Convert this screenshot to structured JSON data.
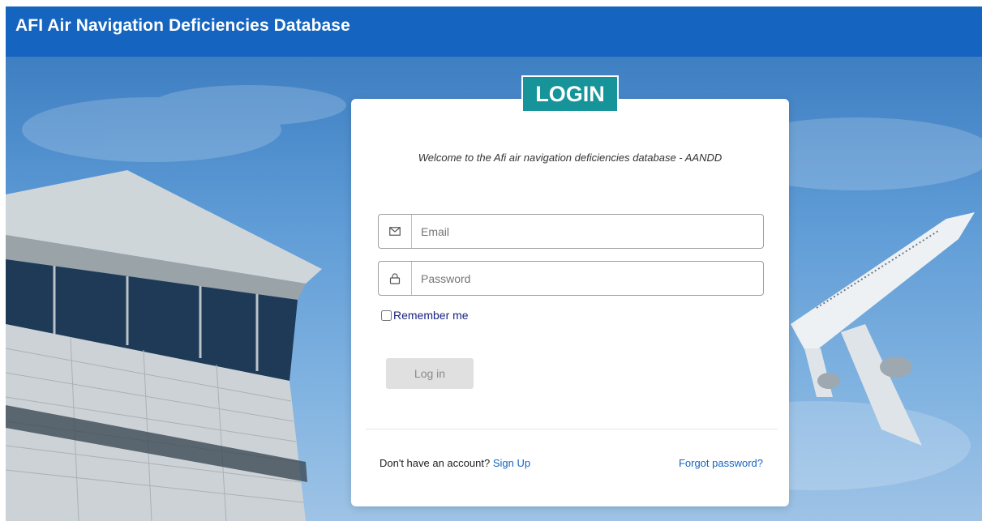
{
  "header": {
    "title": "AFI Air Navigation Deficiencies Database"
  },
  "login": {
    "badge": "LOGIN",
    "welcome": "Welcome to the Afi air navigation deficiencies database - AANDD",
    "email_placeholder": "Email",
    "password_placeholder": "Password",
    "remember_label": "Remember me",
    "login_button": "Log in",
    "no_account_text": "Don't have an account?",
    "signup_link": "Sign Up",
    "forgot_link": "Forgot password?"
  },
  "icons": {
    "email": "mail-icon",
    "password": "lock-icon"
  },
  "colors": {
    "header": "#1565c0",
    "badge": "#17949a",
    "link": "#1565c0",
    "button_disabled": "#e0e0e0"
  }
}
